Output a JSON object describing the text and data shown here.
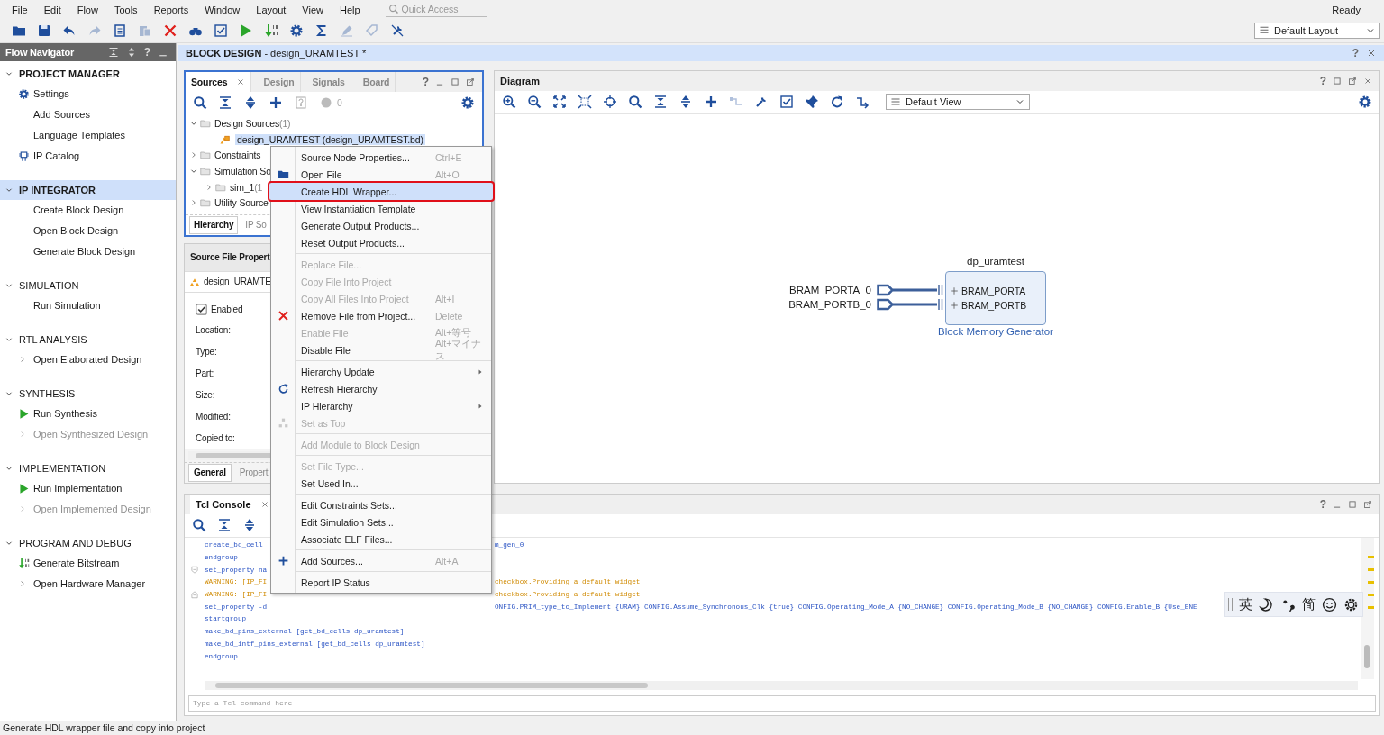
{
  "menu_bar": {
    "items": [
      "File",
      "Edit",
      "Flow",
      "Tools",
      "Reports",
      "Window",
      "Layout",
      "View",
      "Help"
    ],
    "quick_access": {
      "placeholder": "Quick Access"
    },
    "status": "Ready"
  },
  "toolbar": [
    {
      "kind": "folder",
      "disabled": false
    },
    {
      "kind": "save",
      "disabled": false
    },
    {
      "kind": "undo",
      "disabled": false
    },
    {
      "kind": "redo",
      "disabled": true
    },
    {
      "kind": "copy",
      "disabled": false
    },
    {
      "kind": "paste",
      "disabled": true
    },
    {
      "kind": "delete",
      "disabled": false
    },
    {
      "kind": "binoculars",
      "disabled": false
    },
    {
      "kind": "check",
      "disabled": false
    },
    {
      "kind": "play",
      "disabled": false
    },
    {
      "kind": "bitstream",
      "disabled": false
    },
    {
      "kind": "gear",
      "disabled": false
    },
    {
      "kind": "sigma",
      "disabled": false
    },
    {
      "kind": "pen",
      "disabled": true
    },
    {
      "kind": "tag",
      "disabled": true
    },
    {
      "kind": "wrench-off",
      "disabled": false
    }
  ],
  "layout_select": "Default Layout",
  "flow_navigator": {
    "title": "Flow Navigator",
    "help": "?",
    "sections": [
      {
        "title": "PROJECT MANAGER",
        "expanded": true,
        "selected": false,
        "active": true,
        "items": [
          {
            "label": "Settings",
            "kind": "gear",
            "disabled": false
          },
          {
            "label": "Add Sources",
            "kind": "plain",
            "disabled": false
          },
          {
            "label": "Language Templates",
            "kind": "plain",
            "disabled": false
          },
          {
            "label": "IP Catalog",
            "kind": "chip",
            "disabled": false
          }
        ]
      },
      {
        "title": "IP INTEGRATOR",
        "expanded": true,
        "selected": true,
        "active": true,
        "items": [
          {
            "label": "Create Block Design",
            "kind": "plain",
            "disabled": false
          },
          {
            "label": "Open Block Design",
            "kind": "plain",
            "disabled": false
          },
          {
            "label": "Generate Block Design",
            "kind": "plain",
            "disabled": false
          }
        ]
      },
      {
        "title": "SIMULATION",
        "expanded": true,
        "selected": false,
        "active": false,
        "items": [
          {
            "label": "Run Simulation",
            "kind": "plain",
            "disabled": false
          }
        ]
      },
      {
        "title": "RTL ANALYSIS",
        "expanded": true,
        "selected": false,
        "active": false,
        "items": [
          {
            "label": "Open Elaborated Design",
            "kind": "chevron",
            "disabled": false
          }
        ]
      },
      {
        "title": "SYNTHESIS",
        "expanded": true,
        "selected": false,
        "active": false,
        "items": [
          {
            "label": "Run Synthesis",
            "kind": "play",
            "disabled": false
          },
          {
            "label": "Open Synthesized Design",
            "kind": "chevron",
            "disabled": true
          }
        ]
      },
      {
        "title": "IMPLEMENTATION",
        "expanded": true,
        "selected": false,
        "active": false,
        "items": [
          {
            "label": "Run Implementation",
            "kind": "play",
            "disabled": false
          },
          {
            "label": "Open Implemented Design",
            "kind": "chevron",
            "disabled": true
          }
        ]
      },
      {
        "title": "PROGRAM AND DEBUG",
        "expanded": true,
        "selected": false,
        "active": false,
        "items": [
          {
            "label": "Generate Bitstream",
            "kind": "bitstream",
            "disabled": false
          },
          {
            "label": "Open Hardware Manager",
            "kind": "chevron",
            "disabled": false
          }
        ]
      }
    ]
  },
  "editor": {
    "title": "**BLOCK DESIGN** - design_URAMTEST *",
    "help": "?"
  },
  "sources": {
    "tabs": [
      {
        "label": "Sources",
        "selected": true
      },
      {
        "label": "Design",
        "selected": false
      },
      {
        "label": "Signals",
        "selected": false
      },
      {
        "label": "Board",
        "selected": false
      }
    ],
    "help": "?",
    "count": "0",
    "tree": [
      {
        "label": "Design Sources",
        "count": "(1)",
        "kind": "folder",
        "expanded": true,
        "selected": false,
        "children": [
          {
            "label": "design_URAMTEST (design_URAMTEST.bd)",
            "kind": "block-design",
            "selected": true
          }
        ]
      },
      {
        "label": "Constraints",
        "kind": "folder",
        "expanded": false,
        "selected": false
      },
      {
        "label": "Simulation So",
        "kind": "folder",
        "expanded": true,
        "selected": false,
        "children": [
          {
            "label": "sim_1",
            "count": "(1",
            "kind": "folder",
            "expanded": false,
            "selected": false
          }
        ]
      },
      {
        "label": "Utility Source",
        "kind": "folder",
        "expanded": false,
        "selected": false
      }
    ],
    "bottom_tabs": [
      {
        "label": "Hierarchy",
        "selected": true
      },
      {
        "label": "IP So",
        "selected": false
      }
    ]
  },
  "properties": {
    "title": "Source File Propert",
    "file": "design_URAMTE",
    "enabled": {
      "label": "Enabled",
      "checked": true
    },
    "fields": [
      "Location:",
      "Type:",
      "Part:",
      "Size:",
      "Modified:",
      "Copied to:"
    ],
    "tabs": [
      {
        "label": "General",
        "selected": true
      },
      {
        "label": "Propert",
        "selected": false
      }
    ]
  },
  "diagram": {
    "title": "Diagram",
    "help": "?",
    "view_select": "Default View",
    "toolbar": [
      {
        "kind": "zoom-in",
        "disabled": false
      },
      {
        "kind": "zoom-out",
        "disabled": false
      },
      {
        "kind": "fit",
        "disabled": false
      },
      {
        "kind": "fit-selection",
        "disabled": false
      },
      {
        "kind": "target",
        "disabled": false
      },
      {
        "kind": "search",
        "disabled": false
      },
      {
        "kind": "collapse",
        "disabled": false
      },
      {
        "kind": "expand",
        "disabled": false
      },
      {
        "kind": "plus",
        "disabled": false
      },
      {
        "kind": "connect",
        "disabled": true
      },
      {
        "kind": "wrench",
        "disabled": false
      },
      {
        "kind": "check",
        "disabled": false
      },
      {
        "kind": "pin",
        "disabled": false
      },
      {
        "kind": "refresh",
        "disabled": false
      },
      {
        "kind": "route",
        "disabled": false
      }
    ],
    "block": {
      "name": "dp_uramtest",
      "ports": [
        "BRAM_PORTA",
        "BRAM_PORTB"
      ],
      "subtitle": "Block Memory Generator"
    },
    "external_ports": [
      "BRAM_PORTA_0",
      "BRAM_PORTB_0"
    ]
  },
  "context_menu": {
    "groups": [
      {
        "items": [
          {
            "label": "Source Node Properties...",
            "shortcut": "Ctrl+E",
            "kind": "plain",
            "submenu": false,
            "disabled": false,
            "selected": false
          },
          {
            "label": "Open File",
            "shortcut": "Alt+O",
            "kind": "folder",
            "submenu": false,
            "disabled": false,
            "selected": false
          },
          {
            "label": "Create HDL Wrapper...",
            "kind": "plain",
            "submenu": false,
            "disabled": false,
            "selected": true
          },
          {
            "label": "View Instantiation Template",
            "kind": "plain",
            "submenu": false,
            "disabled": false,
            "selected": false
          },
          {
            "label": "Generate Output Products...",
            "kind": "plain",
            "submenu": false,
            "disabled": false,
            "selected": false
          },
          {
            "label": "Reset Output Products...",
            "kind": "plain",
            "submenu": false,
            "disabled": false,
            "selected": false
          }
        ]
      },
      {
        "items": [
          {
            "label": "Replace File...",
            "kind": "plain",
            "submenu": false,
            "disabled": true,
            "selected": false
          },
          {
            "label": "Copy File Into Project",
            "kind": "plain",
            "submenu": false,
            "disabled": true,
            "selected": false
          },
          {
            "label": "Copy All Files Into Project",
            "shortcut": "Alt+I",
            "kind": "plain",
            "submenu": false,
            "disabled": true,
            "selected": false
          },
          {
            "label": "Remove File from Project...",
            "shortcut": "Delete",
            "kind": "delete",
            "submenu": false,
            "disabled": false,
            "selected": false
          },
          {
            "label": "Enable File",
            "shortcut": "Alt+等号",
            "kind": "plain",
            "submenu": false,
            "disabled": true,
            "selected": false
          },
          {
            "label": "Disable File",
            "shortcut": "Alt+マイナス",
            "kind": "plain",
            "submenu": false,
            "disabled": false,
            "selected": false
          }
        ]
      },
      {
        "items": [
          {
            "label": "Hierarchy Update",
            "kind": "plain",
            "submenu": true,
            "disabled": false,
            "selected": false
          },
          {
            "label": "Refresh Hierarchy",
            "kind": "refresh",
            "submenu": false,
            "disabled": false,
            "selected": false
          },
          {
            "label": "IP Hierarchy",
            "kind": "plain",
            "submenu": true,
            "disabled": false,
            "selected": false
          },
          {
            "label": "Set as Top",
            "kind": "hierarchy",
            "submenu": false,
            "disabled": true,
            "selected": false
          }
        ]
      },
      {
        "items": [
          {
            "label": "Add Module to Block Design",
            "kind": "plain",
            "submenu": false,
            "disabled": true,
            "selected": false
          }
        ]
      },
      {
        "items": [
          {
            "label": "Set File Type...",
            "kind": "plain",
            "submenu": false,
            "disabled": true,
            "selected": false
          },
          {
            "label": "Set Used In...",
            "kind": "plain",
            "submenu": false,
            "disabled": false,
            "selected": false
          }
        ]
      },
      {
        "items": [
          {
            "label": "Edit Constraints Sets...",
            "kind": "plain",
            "submenu": false,
            "disabled": false,
            "selected": false
          },
          {
            "label": "Edit Simulation Sets...",
            "kind": "plain",
            "submenu": false,
            "disabled": false,
            "selected": false
          },
          {
            "label": "Associate ELF Files...",
            "kind": "plain",
            "submenu": false,
            "disabled": false,
            "selected": false
          }
        ]
      },
      {
        "items": [
          {
            "label": "Add Sources...",
            "shortcut": "Alt+A",
            "kind": "plus",
            "submenu": false,
            "disabled": false,
            "selected": false
          }
        ]
      },
      {
        "items": [
          {
            "label": "Report IP Status",
            "kind": "plain",
            "submenu": false,
            "disabled": false,
            "selected": false
          }
        ]
      }
    ]
  },
  "tcl_console": {
    "title": "Tcl Console",
    "help": "?",
    "lines": [
      {
        "kind": "command",
        "text": "create_bd_cell",
        "tail": "m_gen_0",
        "fold_start": false,
        "fold_end": false
      },
      {
        "kind": "command",
        "text": "endgroup",
        "fold_start": false,
        "fold_end": false
      },
      {
        "kind": "command",
        "text": "set_property na",
        "fold_start": true,
        "fold_end": false
      },
      {
        "kind": "warning",
        "text": "WARNING: [IP_FI",
        "tail": "checkbox.Providing a default widget",
        "fold_start": false,
        "fold_end": false
      },
      {
        "kind": "warning",
        "text": "WARNING: [IP_FI",
        "tail": "checkbox.Providing a default widget",
        "fold_start": false,
        "fold_end": true
      },
      {
        "kind": "command",
        "text": "set_property -d",
        "tail": "ONFIG.PRIM_type_to_Implement {URAM} CONFIG.Assume_Synchronous_Clk {true} CONFIG.Operating_Mode_A {NO_CHANGE} CONFIG.Operating_Mode_B {NO_CHANGE} CONFIG.Enable_B {Use_ENE",
        "fold_start": false,
        "fold_end": false
      },
      {
        "kind": "command",
        "text": "startgroup",
        "fold_start": false,
        "fold_end": false
      },
      {
        "kind": "command",
        "text": "make_bd_pins_external  [get_bd_cells dp_uramtest]",
        "fold_start": false,
        "fold_end": false
      },
      {
        "kind": "command",
        "text": "make_bd_intf_pins_external  [get_bd_cells dp_uramtest]",
        "fold_start": false,
        "fold_end": false
      },
      {
        "kind": "command",
        "text": "endgroup",
        "fold_start": false,
        "fold_end": false
      }
    ],
    "input": {
      "placeholder": "Type a Tcl command here"
    }
  },
  "ime_toolbar": [
    {
      "kind": "text",
      "label": "英"
    },
    {
      "kind": "moon"
    },
    {
      "kind": "punctuation"
    },
    {
      "kind": "text",
      "label": "简"
    },
    {
      "kind": "smiley"
    },
    {
      "kind": "gear"
    }
  ],
  "status_bar": "Generate HDL wrapper file and copy into project"
}
